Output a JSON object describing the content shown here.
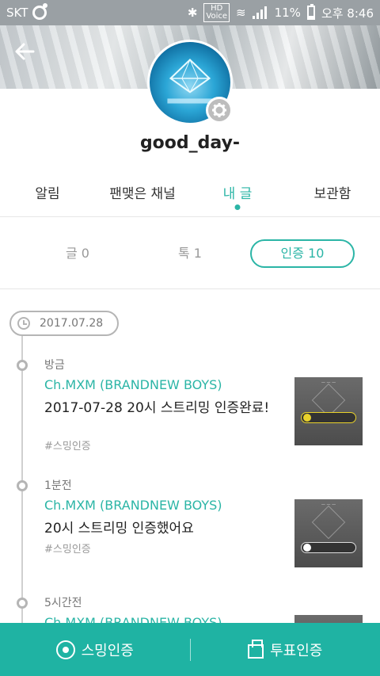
{
  "status": {
    "carrier": "SKT",
    "hd": "HD",
    "hd_sub": "Voice",
    "battery": "11%",
    "time": "오후 8:46"
  },
  "profile": {
    "username": "good_day-"
  },
  "tabs": [
    {
      "label": "알림"
    },
    {
      "label": "팬맺은 채널"
    },
    {
      "label": "내 글"
    },
    {
      "label": "보관함"
    }
  ],
  "filters": [
    {
      "label": "글 0"
    },
    {
      "label": "톡 1"
    },
    {
      "label": "인증 10"
    }
  ],
  "timeline": {
    "date": "2017.07.28",
    "posts": [
      {
        "time": "방금",
        "channel": "Ch.MXM (BRANDNEW BOYS)",
        "body": "2017-07-28 20시 스트리밍 인증완료!",
        "tag": "#스밍인증"
      },
      {
        "time": "1분전",
        "channel": "Ch.MXM (BRANDNEW BOYS)",
        "body": "20시 스트리밍 인증했어요",
        "tag": "#스밍인증"
      },
      {
        "time": "5시간전",
        "channel": "Ch.MXM (BRANDNEW BOYS)",
        "body": "",
        "tag": ""
      }
    ]
  },
  "bottom": {
    "streaming_label": "스밍인증",
    "vote_label": "투표인증"
  },
  "colors": {
    "accent": "#2bb5a6",
    "bottom_bar": "#1fb3a3"
  }
}
